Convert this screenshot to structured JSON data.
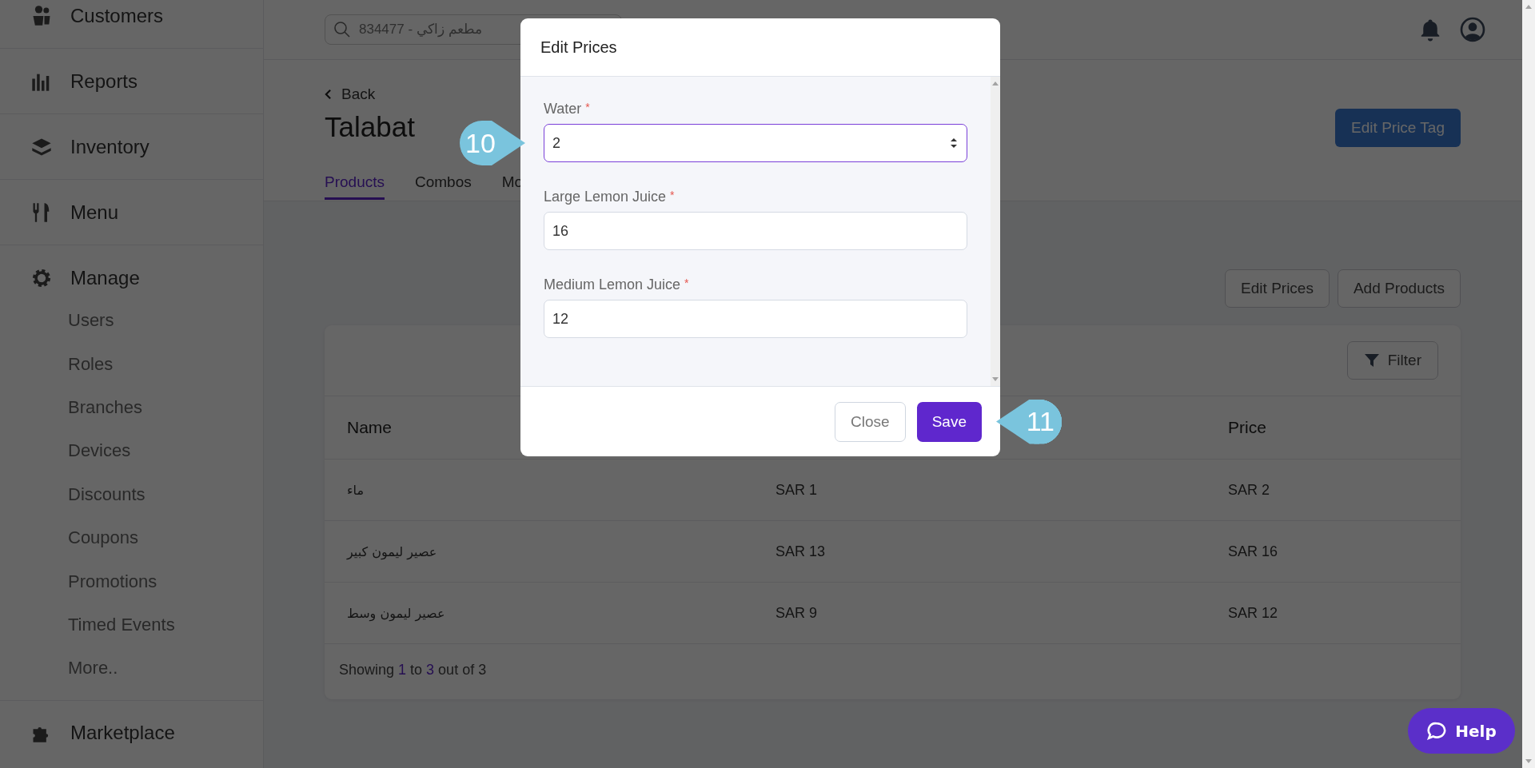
{
  "sidebar": {
    "items": [
      {
        "label": "Customers"
      },
      {
        "label": "Reports"
      },
      {
        "label": "Inventory"
      },
      {
        "label": "Menu"
      },
      {
        "label": "Manage",
        "children": [
          {
            "label": "Users"
          },
          {
            "label": "Roles"
          },
          {
            "label": "Branches"
          },
          {
            "label": "Devices"
          },
          {
            "label": "Discounts"
          },
          {
            "label": "Coupons"
          },
          {
            "label": "Promotions"
          },
          {
            "label": "Timed Events"
          },
          {
            "label": "More.."
          }
        ]
      },
      {
        "label": "Marketplace"
      }
    ]
  },
  "header": {
    "search": {
      "placeholder": "مطعم زاكي - 834477"
    }
  },
  "page": {
    "back": "Back",
    "title": "Talabat",
    "edit_price_tag": "Edit Price Tag",
    "tabs": [
      {
        "label": "Products",
        "selected": true
      },
      {
        "label": "Combos",
        "selected": false
      },
      {
        "label": "Mo",
        "selected": false
      }
    ],
    "actions": [
      "Edit Prices",
      "Add Products"
    ],
    "filter": "Filter",
    "table": {
      "columns": {
        "name": "Name",
        "price": "Price"
      },
      "rows": [
        {
          "name": "ماء",
          "column_2": "SAR 1",
          "price": "SAR 2"
        },
        {
          "name": "عصير ليمون كبير",
          "column_2": "SAR 13",
          "price": "SAR 16"
        },
        {
          "name": "عصير ليمون وسط",
          "column_2": "SAR 9",
          "price": "SAR 12"
        }
      ],
      "footer": "Showing **1** to **3** out of 3"
    }
  },
  "modal": {
    "title": "Edit Prices",
    "fields": [
      {
        "label": "Water",
        "required_mark": "*",
        "value": "2",
        "focused": true,
        "callout": "10"
      },
      {
        "label": "Large Lemon Juice",
        "required_mark": "*",
        "value": "16",
        "focused": false
      },
      {
        "label": "Medium Lemon Juice",
        "required_mark": "*",
        "value": "12",
        "focused": false
      }
    ],
    "close": "Close",
    "save": "Save",
    "save_callout": "11"
  },
  "help": "Help"
}
